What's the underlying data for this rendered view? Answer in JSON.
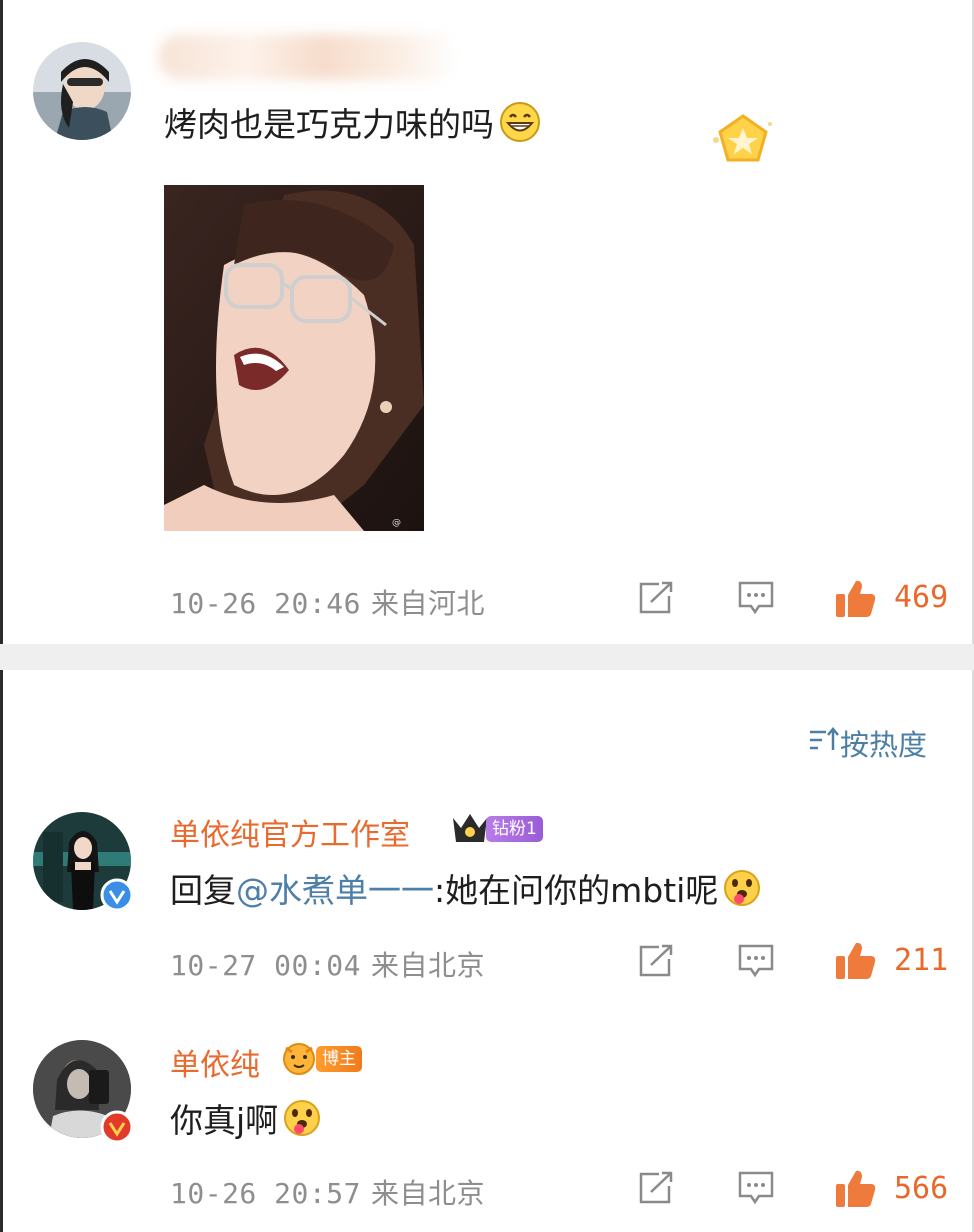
{
  "post": {
    "text": "烤肉也是巧克力味的吗",
    "emoji_icon": "grin-emoji-icon",
    "date": "10-26 20:46",
    "location": "来自河北",
    "like_count": "469"
  },
  "sort": {
    "label": "按热度",
    "icon": "sort-icon"
  },
  "comments": [
    {
      "username": "单依纯官方工作室",
      "badge": "钻粉1",
      "reply_prefix": "回复",
      "mention": "@水煮单一一",
      "text": ":她在问你的mbti呢",
      "date": "10-27 00:04",
      "location": "来自北京",
      "like_count": "211",
      "verify_color": "#3a8ee6"
    },
    {
      "username": "单依纯",
      "badge": "博主",
      "text": "你真j啊",
      "date": "10-26 20:57",
      "location": "来自北京",
      "like_count": "566",
      "verify_color": "#e23a2a"
    }
  ],
  "colors": {
    "accent_orange": "#e8692b",
    "link_blue": "#4d7fa8",
    "meta_gray": "#8e8e8e"
  }
}
